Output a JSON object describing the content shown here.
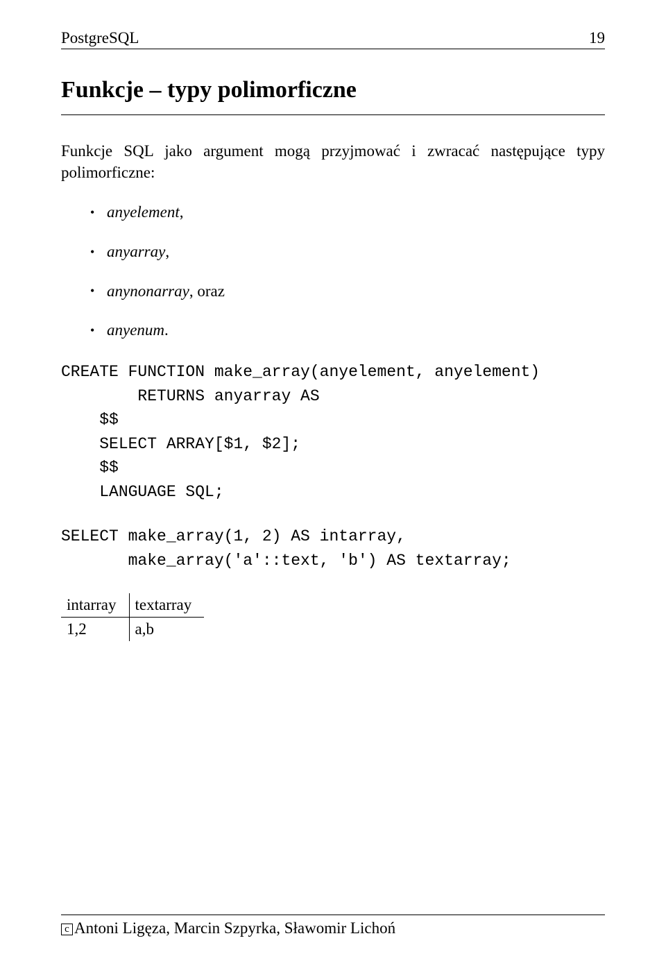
{
  "header": {
    "running_title": "PostgreSQL",
    "page_number": "19"
  },
  "section": {
    "title": "Funkcje – typy polimorficzne"
  },
  "paragraph": "Funkcje SQL jako argument mogą przyjmować i zwracać następujące typy polimorficzne:",
  "list": {
    "items": [
      {
        "name": "anyelement",
        "suffix": ","
      },
      {
        "name": "anyarray",
        "suffix": ","
      },
      {
        "name": "anynonarray",
        "suffix": ", oraz"
      },
      {
        "name": "anyenum",
        "suffix": "."
      }
    ]
  },
  "code1": "CREATE FUNCTION make_array(anyelement, anyelement)\n        RETURNS anyarray AS\n    $$\n    SELECT ARRAY[$1, $2];\n    $$\n    LANGUAGE SQL;",
  "code2": "SELECT make_array(1, 2) AS intarray,\n       make_array('a'::text, 'b') AS textarray;",
  "table": {
    "headers": [
      "intarray",
      "textarray"
    ],
    "rows": [
      [
        "1,2",
        "a,b"
      ]
    ]
  },
  "footer": {
    "prefix": "c",
    "text": "Antoni Ligęza, Marcin Szpyrka, Sławomir Lichoń"
  }
}
